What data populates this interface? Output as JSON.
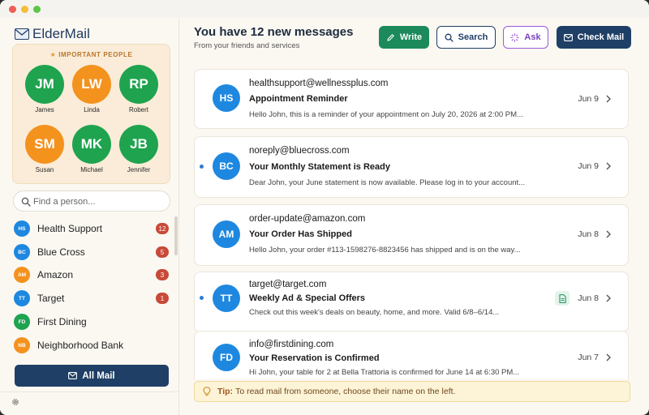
{
  "app": {
    "name": "ElderMail"
  },
  "important": {
    "title": "IMPORTANT PEOPLE",
    "people": [
      {
        "initials": "JM",
        "name": "James",
        "color": "#1fa34f"
      },
      {
        "initials": "LW",
        "name": "Linda",
        "color": "#f4921e"
      },
      {
        "initials": "RP",
        "name": "Robert",
        "color": "#1fa34f"
      },
      {
        "initials": "SM",
        "name": "Susan",
        "color": "#f4921e"
      },
      {
        "initials": "MK",
        "name": "Michael",
        "color": "#1fa34f"
      },
      {
        "initials": "JB",
        "name": "Jennifer",
        "color": "#1fa34f"
      }
    ]
  },
  "find": {
    "placeholder": "Find a person..."
  },
  "senders": [
    {
      "initials": "HS",
      "name": "Health Support",
      "count": "12",
      "color": "#1e88e0"
    },
    {
      "initials": "BC",
      "name": "Blue Cross",
      "count": "5",
      "color": "#1e88e0"
    },
    {
      "initials": "AM",
      "name": "Amazon",
      "count": "3",
      "color": "#f4921e"
    },
    {
      "initials": "TT",
      "name": "Target",
      "count": "1",
      "color": "#1e88e0"
    },
    {
      "initials": "FD",
      "name": "First Dining",
      "count": "",
      "color": "#1fa34f"
    },
    {
      "initials": "NB",
      "name": "Neighborhood Bank",
      "count": "",
      "color": "#f4921e"
    }
  ],
  "all_mail_label": "All Mail",
  "header": {
    "title": "You have 12 new messages",
    "subtitle": "From your friends and services"
  },
  "toolbar": {
    "write": "Write",
    "search": "Search",
    "ask": "Ask",
    "check": "Check Mail"
  },
  "messages": [
    {
      "initials": "HS",
      "from": "healthsupport@wellnessplus.com",
      "subject": "Appointment Reminder",
      "preview": "Hello John, this is a reminder of your appointment on July 20, 2026 at 2:00 PM...",
      "date": "Jun 9",
      "unread": false,
      "attachment": false
    },
    {
      "initials": "BC",
      "from": "noreply@bluecross.com",
      "subject": "Your Monthly Statement is Ready",
      "preview": "Dear John, your June statement is now available. Please log in to your account...",
      "date": "Jun 9",
      "unread": true,
      "attachment": false
    },
    {
      "initials": "AM",
      "from": "order-update@amazon.com",
      "subject": "Your Order Has Shipped",
      "preview": "Hello John, your order #113-1598276-8823456 has shipped and is on the way...",
      "date": "Jun 8",
      "unread": false,
      "attachment": false
    },
    {
      "initials": "TT",
      "from": "target@target.com",
      "subject": "Weekly Ad & Special Offers",
      "preview": "Check out this week's deals on beauty, home, and more. Valid 6/8–6/14...",
      "date": "Jun 8",
      "unread": true,
      "attachment": true
    },
    {
      "initials": "FD",
      "from": "info@firstdining.com",
      "subject": "Your Reservation is Confirmed",
      "preview": "Hi John, your table for 2 at Bella Trattoria is confirmed for June 14 at 6:30 PM...",
      "date": "Jun 7",
      "unread": false,
      "attachment": false
    }
  ],
  "tip": {
    "label": "Tip:",
    "text": "To read mail from someone, choose their name on the left."
  }
}
